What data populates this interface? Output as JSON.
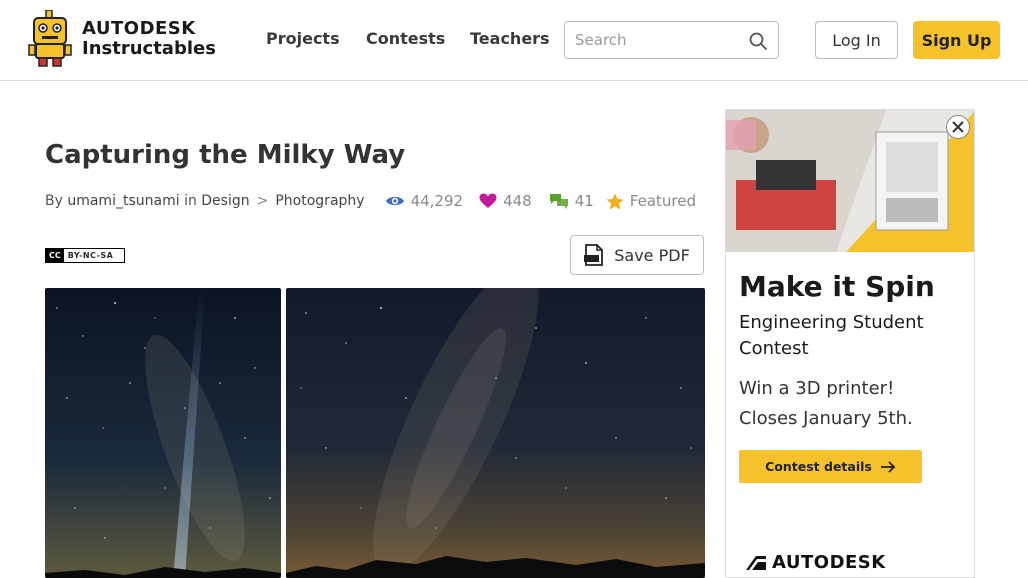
{
  "header": {
    "logo_brand": "AUTODESK",
    "logo_product": "Instructables",
    "nav": [
      "Projects",
      "Contests",
      "Teachers"
    ],
    "search_placeholder": "Search",
    "login_label": "Log In",
    "signup_label": "Sign Up"
  },
  "article": {
    "title": "Capturing the Milky Way",
    "by_label": "By",
    "author": "umami_tsunami",
    "in_label": "in",
    "category": "Design",
    "separator": ">",
    "subcategory": "Photography",
    "views": "44,292",
    "favorites": "448",
    "comments": "41",
    "featured_label": "Featured",
    "license_cc": "CC",
    "license": "BY-NC-SA",
    "save_pdf_label": "Save PDF"
  },
  "ad": {
    "title": "Make it Spin",
    "subtitle": "Engineering Student Contest",
    "body_line1": "Win a 3D printer!",
    "body_line2": "Closes January 5th.",
    "cta_label": "Contest details",
    "brand": "AUTODESK"
  },
  "colors": {
    "accent_yellow": "#f5c22b",
    "view_icon": "#3a6fc4",
    "heart_icon": "#c21c9a",
    "comment_icon": "#5aa02c",
    "star_icon": "#f0b020"
  },
  "icons": [
    "robot-logo-icon",
    "search-icon",
    "eye-icon",
    "heart-icon",
    "comment-icon",
    "star-icon",
    "pdf-icon",
    "close-icon",
    "arrow-right-icon",
    "autodesk-logo-icon"
  ]
}
